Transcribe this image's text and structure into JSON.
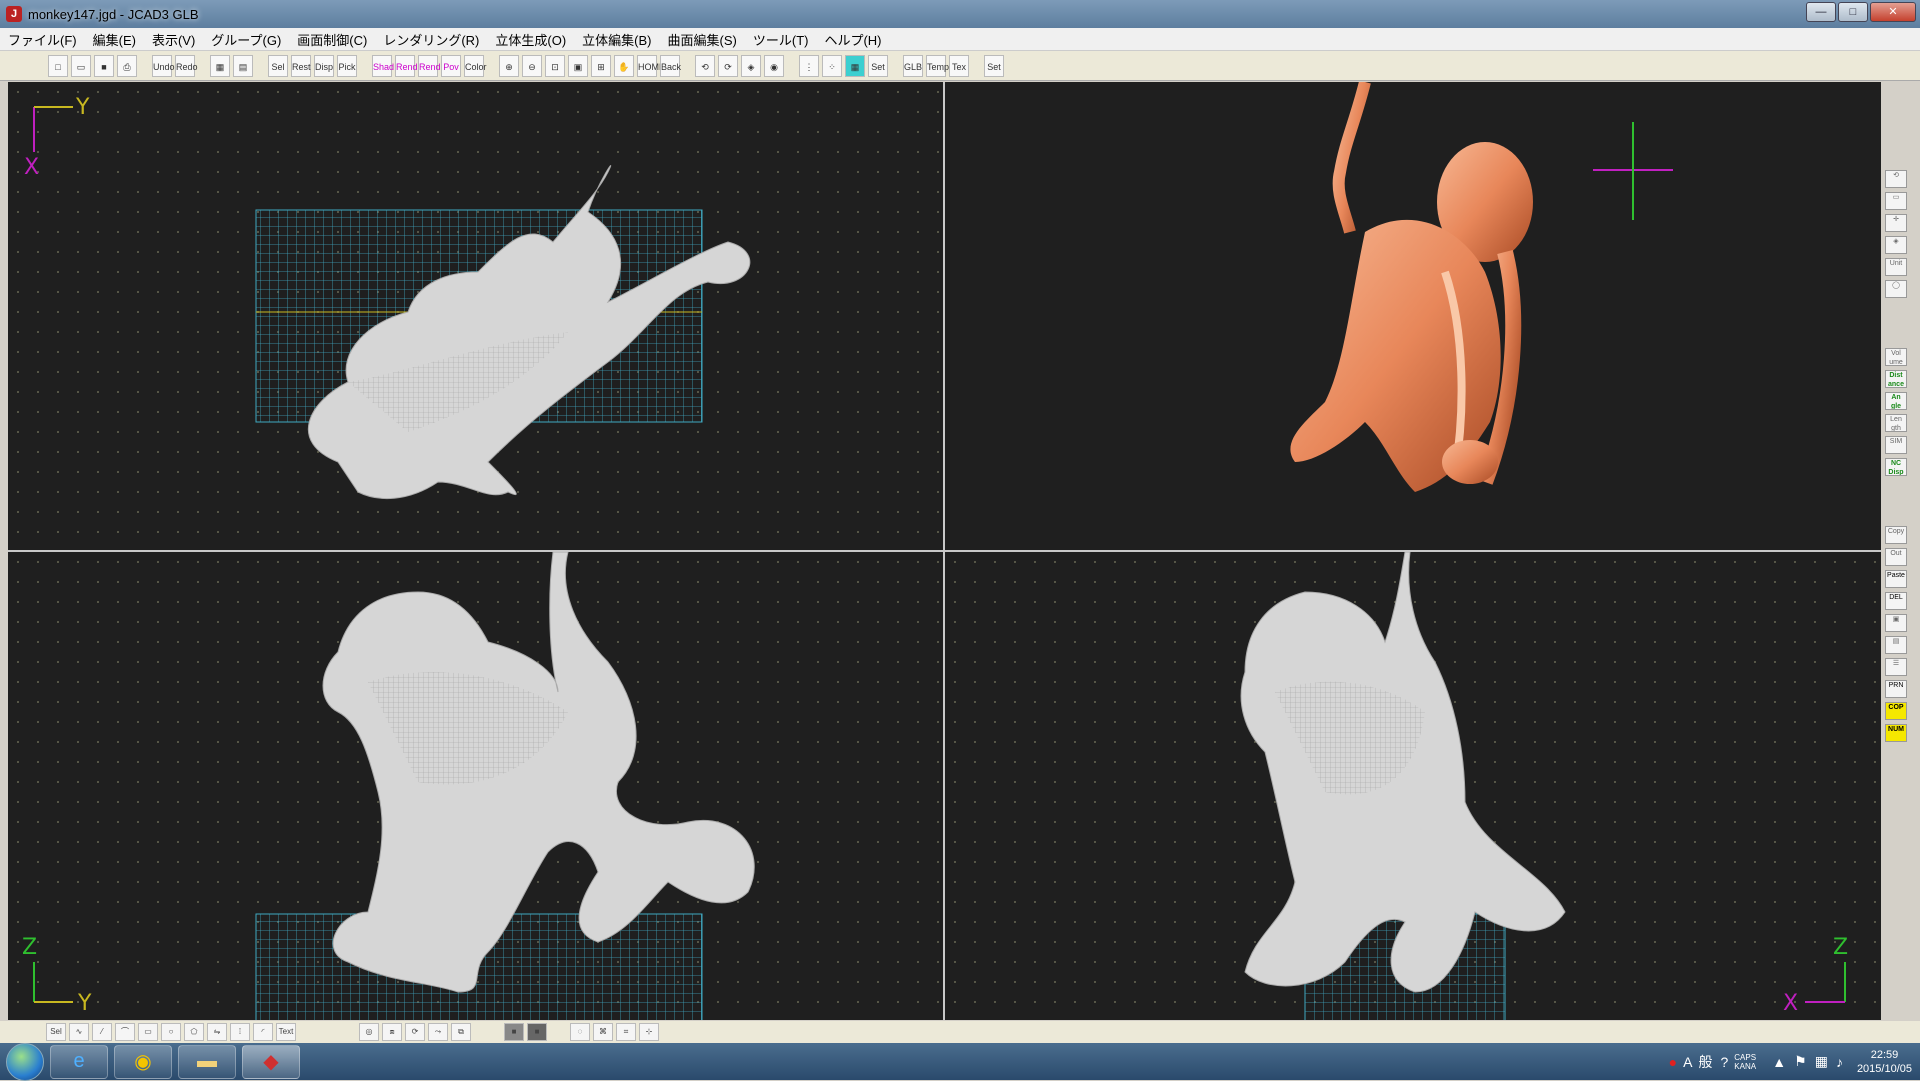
{
  "window": {
    "title": "monkey147.jgd - JCAD3 GLB",
    "app_icon": "jcad-icon",
    "buttons": {
      "minimize": "—",
      "maximize": "□",
      "close": "✕"
    }
  },
  "menu": {
    "items": [
      "ファイル(F)",
      "編集(E)",
      "表示(V)",
      "グループ(G)",
      "画面制御(C)",
      "レンダリング(R)",
      "立体生成(O)",
      "立体編集(B)",
      "曲面編集(S)",
      "ツール(T)",
      "ヘルプ(H)"
    ]
  },
  "toolbar": {
    "groups": [
      [
        "new",
        "open",
        "save",
        "print"
      ],
      [
        "Undo",
        "Redo"
      ],
      [
        "view1",
        "view2"
      ],
      [
        "Sel Grp",
        "Rest Grp",
        "Disp Grp",
        "Pick Grp"
      ],
      [
        "Shad O.GL",
        "Rend O.GL",
        "Rend Ray",
        "Pov",
        "Color"
      ],
      [
        "zoom-in",
        "zoom-out",
        "zoom-win",
        "zoom-fit",
        "zoom-all",
        "pan",
        "HOME",
        "Back"
      ],
      [
        "rot1",
        "rot2",
        "rot3",
        "rot4"
      ],
      [
        "grid",
        "snap",
        "fill"
      ],
      [
        "Set Base"
      ],
      [
        "GLB"
      ],
      [
        "Temp late",
        "Tex ture"
      ],
      [
        "Set Home"
      ]
    ]
  },
  "viewports": {
    "top_left": {
      "axis_h": "Y",
      "axis_v": "X"
    },
    "bottom_left": {
      "axis_h": "Y",
      "axis_v": "Z"
    },
    "bottom_right": {
      "axis_h": "X",
      "axis_v": "Z"
    }
  },
  "side_tools": [
    "rotate",
    "box",
    "move",
    "perspective",
    "Unit",
    "circle",
    "Vol ume",
    "Dist ance",
    "An gle",
    "Len gth",
    "SIM",
    "NC Disp",
    "Copy",
    "Out",
    "Paste",
    "DEL",
    "img1",
    "img2",
    "list",
    "PRN",
    "COP",
    "NUM"
  ],
  "bottom_tools": [
    "Sel",
    "curve",
    "Text"
  ],
  "taskbar": {
    "apps": [
      "ie-icon",
      "chrome-icon",
      "explorer-icon",
      "jcad-icon"
    ],
    "ime_mode": "A",
    "ime_label": "般",
    "tray_text": "CAPS KANA",
    "time": "22:59",
    "date": "2015/10/05"
  },
  "colors": {
    "viewport_bg": "#1f1f1f",
    "wireframe": "#d0d0d0",
    "grid_plane": "#3fa8c0",
    "render_model": "#e8875a",
    "axis_green": "#2fbf2f",
    "axis_magenta": "#c020c0",
    "axis_yellow": "#d8c830"
  }
}
